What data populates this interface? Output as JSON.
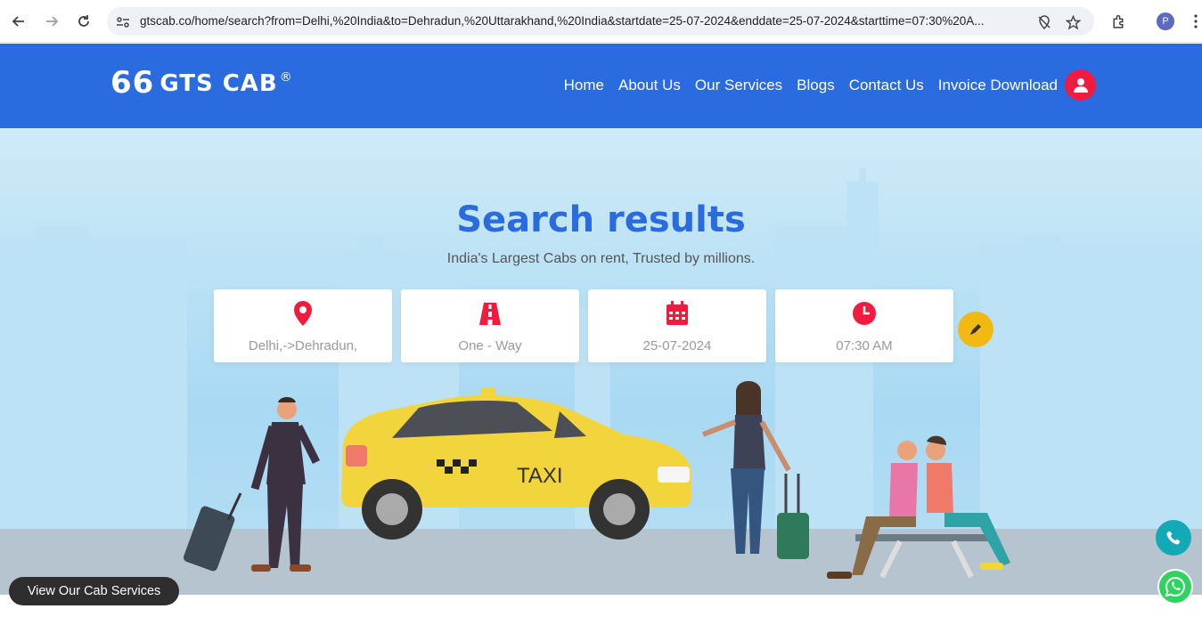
{
  "browser": {
    "url": "gtscab.co/home/search?from=Delhi,%20India&to=Dehradun,%20Uttarakhand,%20India&startdate=25-07-2024&enddate=25-07-2024&starttime=07:30%20A...",
    "profile_initial": "P"
  },
  "site": {
    "logo": {
      "quote": "66",
      "text": "GTS CAB",
      "reg": "®"
    },
    "menu": [
      "Home",
      "About Us",
      "Our Services",
      "Blogs",
      "Contact Us",
      "Invoice Download"
    ],
    "colors": {
      "header": "#2a6bdf",
      "accent": "#f01b3e",
      "title": "#2a6bdf",
      "edit": "#f1b911"
    }
  },
  "hero": {
    "title": "Search results",
    "subtitle": "India's Largest Cabs on rent, Trusted by millions.",
    "cards": [
      {
        "icon": "location-pin-icon",
        "value": "Delhi,->Dehradun,"
      },
      {
        "icon": "road-icon",
        "value": "One - Way"
      },
      {
        "icon": "calendar-icon",
        "value": "25-07-2024"
      },
      {
        "icon": "clock-icon",
        "value": "07:30 AM"
      }
    ],
    "taxi_sign": "TAXI"
  },
  "floating": {
    "view_services": "View Our Cab Services"
  }
}
